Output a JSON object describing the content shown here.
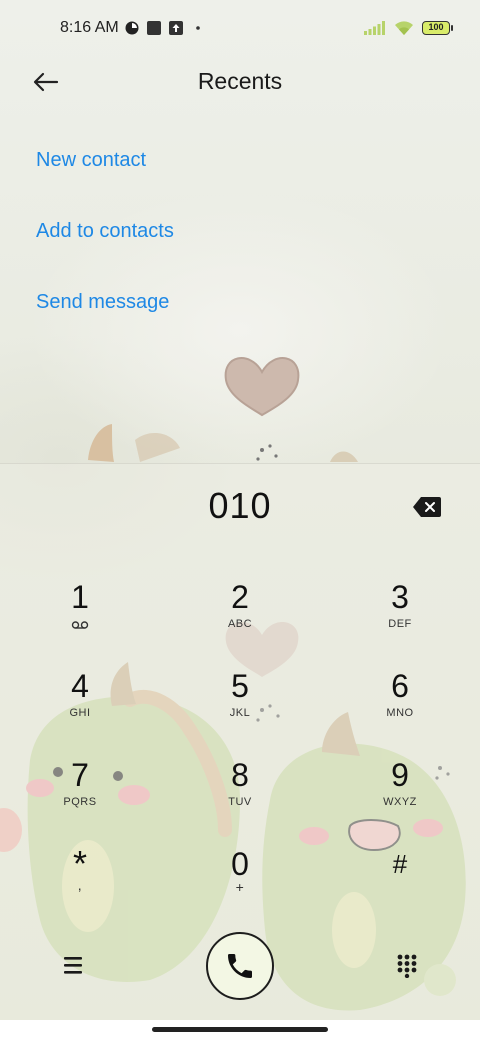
{
  "status_bar": {
    "time": "8:16 AM",
    "battery": "100",
    "icons": [
      "theme-icon",
      "stop-icon",
      "upload-icon",
      "dot-icon",
      "signal-icon",
      "wifi-icon",
      "battery-icon"
    ]
  },
  "header": {
    "title": "Recents",
    "back_icon": "arrow-left-icon"
  },
  "actions": [
    {
      "label": "New contact"
    },
    {
      "label": "Add to contacts"
    },
    {
      "label": "Send message"
    }
  ],
  "dialer": {
    "number": "010",
    "keys": [
      {
        "digit": "1",
        "letters": ""
      },
      {
        "digit": "2",
        "letters": "ABC"
      },
      {
        "digit": "3",
        "letters": "DEF"
      },
      {
        "digit": "4",
        "letters": "GHI"
      },
      {
        "digit": "5",
        "letters": "JKL"
      },
      {
        "digit": "6",
        "letters": "MNO"
      },
      {
        "digit": "7",
        "letters": "PQRS"
      },
      {
        "digit": "8",
        "letters": "TUV"
      },
      {
        "digit": "9",
        "letters": "WXYZ"
      },
      {
        "digit": "*",
        "letters": ","
      },
      {
        "digit": "0",
        "letters": "+"
      },
      {
        "digit": "#",
        "letters": ""
      }
    ]
  },
  "colors": {
    "link": "#1e88e5",
    "battery_fill": "#d9ec6a",
    "call_button_bg": "#f3f7e4"
  }
}
